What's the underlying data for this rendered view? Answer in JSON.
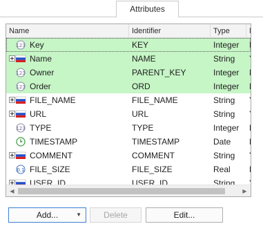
{
  "tab": {
    "label": "Attributes"
  },
  "columns": [
    "Name",
    "Identifier",
    "Type",
    "Nu"
  ],
  "rows": [
    {
      "name": "Key",
      "identifier": "KEY",
      "type": "Integer",
      "nullable": "No",
      "icon": "numeric-attribute-icon",
      "expandable": false,
      "highlighted": true
    },
    {
      "name": "Name",
      "identifier": "NAME",
      "type": "String",
      "nullable": "Yes",
      "icon": "string-flag-icon",
      "expandable": true,
      "highlighted": true
    },
    {
      "name": "Owner",
      "identifier": "PARENT_KEY",
      "type": "Integer",
      "nullable": "No",
      "icon": "numeric-attribute-icon",
      "expandable": false,
      "highlighted": true
    },
    {
      "name": "Order",
      "identifier": "ORD",
      "type": "Integer",
      "nullable": "No",
      "icon": "numeric-attribute-icon",
      "expandable": false,
      "highlighted": true
    },
    {
      "name": "FILE_NAME",
      "identifier": "FILE_NAME",
      "type": "String",
      "nullable": "Yes",
      "icon": "string-flag-icon",
      "expandable": true,
      "highlighted": false
    },
    {
      "name": "URL",
      "identifier": "URL",
      "type": "String",
      "nullable": "Yes",
      "icon": "string-flag-icon",
      "expandable": true,
      "highlighted": false
    },
    {
      "name": "TYPE",
      "identifier": "TYPE",
      "type": "Integer",
      "nullable": "No",
      "icon": "numeric-attribute-icon",
      "expandable": false,
      "highlighted": false
    },
    {
      "name": "TIMESTAMP",
      "identifier": "TIMESTAMP",
      "type": "Date",
      "nullable": "No",
      "icon": "date-clock-icon",
      "expandable": false,
      "highlighted": false
    },
    {
      "name": "COMMENT",
      "identifier": "COMMENT",
      "type": "String",
      "nullable": "Yes",
      "icon": "string-flag-icon",
      "expandable": true,
      "highlighted": false
    },
    {
      "name": "FILE_SIZE",
      "identifier": "FILE_SIZE",
      "type": "Real",
      "nullable": "No",
      "icon": "real-number-icon",
      "expandable": false,
      "highlighted": false
    },
    {
      "name": "USER_ID",
      "identifier": "USER_ID",
      "type": "String",
      "nullable": "Yes",
      "icon": "string-flag-icon",
      "expandable": true,
      "highlighted": false
    }
  ],
  "buttons": {
    "add": "Add...",
    "delete": "Delete",
    "edit": "Edit..."
  },
  "colors": {
    "highlight": "#c6f5c6",
    "accent": "#3c7fd6"
  }
}
